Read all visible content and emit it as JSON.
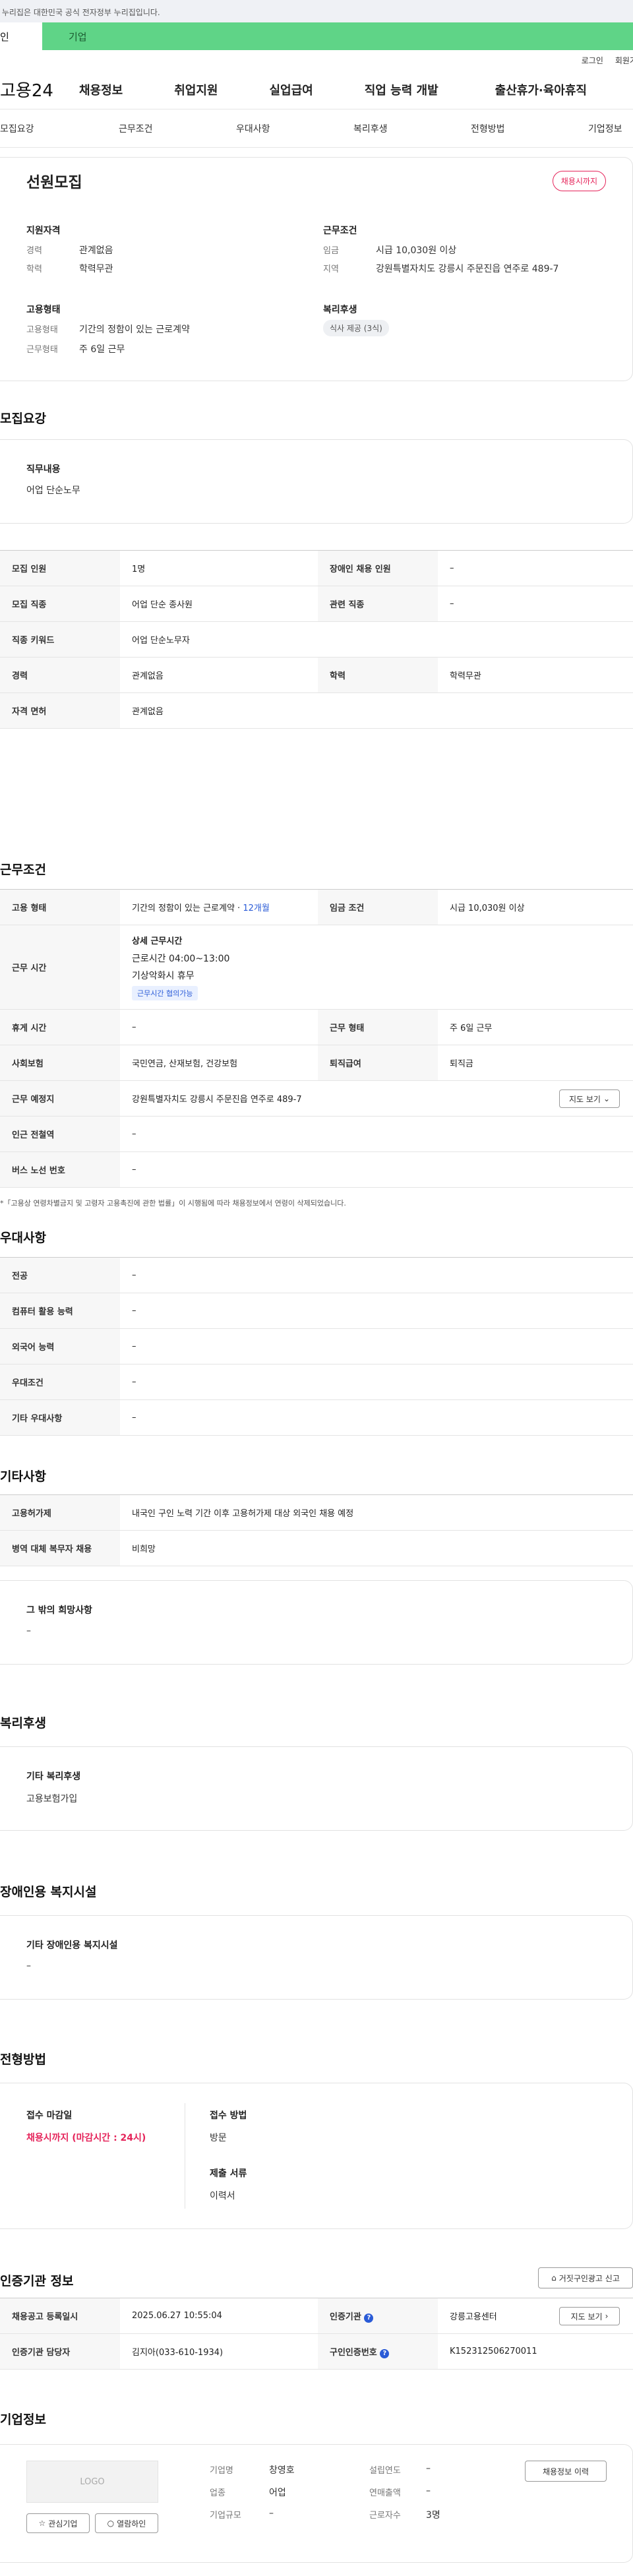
{
  "top": {
    "notice": "이 누리집은 대한민국 공식 전자정부 누리집입니다.",
    "tabs": [
      "인",
      "기업"
    ]
  },
  "util": {
    "login": "로그인",
    "join": "회원가"
  },
  "gnb": {
    "logo": "고용24",
    "menus": [
      "채용정보",
      "취업지원",
      "실업급여",
      "직업 능력 개발",
      "출산휴가·육아휴직"
    ]
  },
  "snb": [
    "모집요강",
    "근무조건",
    "우대사항",
    "복리후생",
    "전형방법",
    "기업정보"
  ],
  "summary": {
    "title": "선원모집",
    "badge": "채용시까지",
    "qual_title": "지원자격",
    "career_label": "경력",
    "career": "관계없음",
    "edu_label": "학력",
    "edu": "학력무관",
    "emp_title": "고용형태",
    "emptype_label": "고용형태",
    "emptype": "기간의 정함이 있는 근로계약",
    "worktype_label": "근무형태",
    "worktype": "주 6일 근무",
    "cond_title": "근무조건",
    "wage_label": "임금",
    "wage": "시급 10,030원 이상",
    "region_label": "지역",
    "region": "강원특별자치도 강릉시 주문진읍 연주로 489-7",
    "welfare_title": "복리후생",
    "welfare_pill": "식사 제공 (3식)"
  },
  "recruit": {
    "title": "모집요강",
    "duty_label": "직무내용",
    "duty": "어업 단순노무",
    "rows": [
      {
        "h1": "모집 인원",
        "v1": "1명",
        "h2": "장애인 채용 인원",
        "v2": "–"
      },
      {
        "h1": "모집 직종",
        "v1": "어업 단순 종사원",
        "h2": "관련 직종",
        "v2": "–"
      },
      {
        "h1": "직종 키워드",
        "v1": "어업 단순노무자"
      },
      {
        "h1": "경력",
        "v1": "관계없음",
        "h2": "학력",
        "v2": "학력무관"
      },
      {
        "h1": "자격 면허",
        "v1": "관계없음"
      }
    ]
  },
  "work": {
    "title": "근무조건",
    "emp_h": "고용 형태",
    "emp_v": "기간의 정함이 있는 근로계약 · ",
    "emp_months": "12개월",
    "wage_h": "임금 조건",
    "wage_v": "시급 10,030원 이상",
    "time_h": "근무 시간",
    "time_detail_title": "상세 근무시간",
    "time_detail": "근로시간 04:00~13:00",
    "time_weather": "기상악화시 휴무",
    "time_tag": "근무시간 협의가능",
    "rest_h": "휴게 시간",
    "rest_v": "–",
    "form_h": "근무 형태",
    "form_v": "주 6일 근무",
    "ins_h": "사회보험",
    "ins_v": "국민연금, 산재보험, 건강보험",
    "sev_h": "퇴직급여",
    "sev_v": "퇴직금",
    "place_h": "근무 예정지",
    "place_v": "강원특별자치도 강릉시 주문진읍 연주로 489-7",
    "map_btn": "지도 보기",
    "subway_h": "인근 전철역",
    "subway_v": "–",
    "bus_h": "버스 노선 번호",
    "bus_v": "–",
    "footnote": "*「고용상 연령차별금지 및 고령자 고용촉진에 관한 법률」이 시행됨에 따라 채용정보에서 연령이 삭제되었습니다."
  },
  "pref": {
    "title": "우대사항",
    "rows": [
      {
        "h": "전공",
        "v": "–"
      },
      {
        "h": "컴퓨터 활용 능력",
        "v": "–"
      },
      {
        "h": "외국어 능력",
        "v": "–"
      },
      {
        "h": "우대조건",
        "v": "–"
      },
      {
        "h": "기타 우대사항",
        "v": "–"
      }
    ]
  },
  "etc": {
    "title": "기타사항",
    "rows": [
      {
        "h": "고용허가제",
        "v": "내국인 구인 노력 기간 이후 고용허가제 대상 외국인 채용 예정"
      },
      {
        "h": "병역 대체 복무자 채용",
        "v": "비희망"
      }
    ],
    "wish_label": "그 밖의 희망사항",
    "wish": "–"
  },
  "welfare": {
    "title": "복리후생",
    "label": "기타 복리후생",
    "value": "고용보험가입"
  },
  "disabled": {
    "title": "장애인용 복지시설",
    "label": "기타 장애인용 복지시설",
    "value": "–"
  },
  "process": {
    "title": "전형방법",
    "deadline_label": "접수 마감일",
    "deadline": "채용시까지 (마감시간 : 24시)",
    "method_label": "접수 방법",
    "method": "방문",
    "docs_label": "제출 서류",
    "docs": "이력서"
  },
  "agency": {
    "title": "인증기관 정보",
    "report_btn": "거짓구인광고 신고",
    "reg_h": "채용공고 등록일시",
    "reg_v": "2025.06.27 10:55:04",
    "org_h": "인증기관",
    "org_v": "강릉고용센터",
    "map_btn": "지도 보기",
    "mgr_h": "인증기관 담당자",
    "mgr_v": "김지아(033-610-1934)",
    "no_h": "구인인증번호",
    "no_v": "K152312506270011"
  },
  "company": {
    "title": "기업정보",
    "logo": "LOGO",
    "fav_btn": "관심기업",
    "view_btn": "열람하인",
    "name_label": "기업명",
    "name": "창영호",
    "industry_label": "업종",
    "industry": "어업",
    "size_label": "기업규모",
    "size": "–",
    "est_label": "설립연도",
    "est": "–",
    "sales_label": "연매출액",
    "sales": "–",
    "emp_label": "근로자수",
    "emp": "3명",
    "history_btn": "채용정보 이력"
  },
  "colors": {
    "green": "#5fd487",
    "red": "#e5245a",
    "blue": "#2a5bd7"
  }
}
